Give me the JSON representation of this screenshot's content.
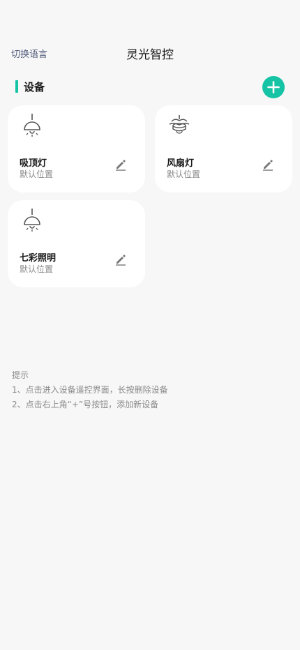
{
  "header": {
    "lang_switch": "切换语言",
    "title": "灵光智控"
  },
  "section": {
    "title": "设备",
    "add_icon": "plus-icon"
  },
  "devices": [
    {
      "name": "吸顶灯",
      "location": "默认位置",
      "icon": "ceiling-lamp-icon"
    },
    {
      "name": "风扇灯",
      "location": "默认位置",
      "icon": "fan-lamp-icon"
    },
    {
      "name": "七彩照明",
      "location": "默认位置",
      "icon": "ceiling-lamp-icon"
    }
  ],
  "tips": {
    "title": "提示",
    "lines": [
      "1、点击进入设备遥控界面，长按删除设备",
      "2、点击右上角“+”号按钮，添加新设备"
    ]
  },
  "colors": {
    "accent": "#17c3a5",
    "background": "#f7f7f7",
    "card": "#ffffff",
    "link": "#4f5a7a",
    "muted": "#8a8a8a"
  }
}
